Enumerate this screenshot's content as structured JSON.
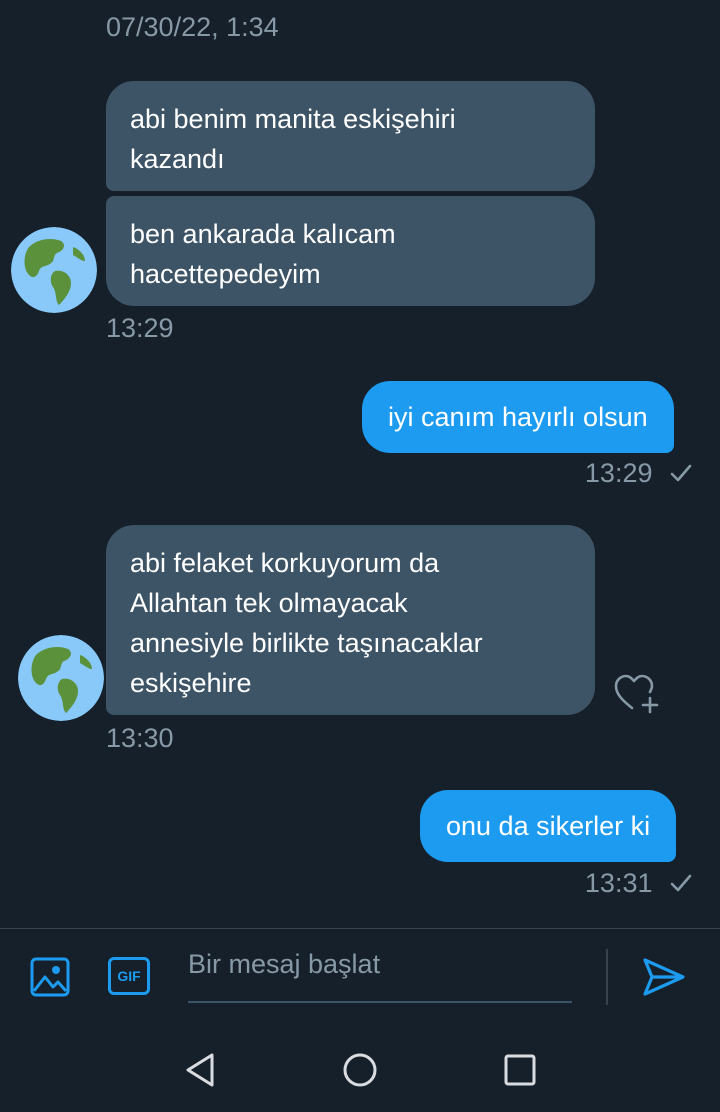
{
  "conversation": {
    "top_timestamp": "07/30/22, 1:34",
    "groups": [
      {
        "direction": "incoming",
        "messages": [
          {
            "lines": [
              "abi benim manita eskişehiri",
              "kazandı"
            ]
          },
          {
            "lines": [
              "ben ankarada kalıcam",
              "hacettepedeyim"
            ]
          }
        ],
        "time": "13:29"
      },
      {
        "direction": "outgoing",
        "messages": [
          {
            "lines": [
              "iyi canım hayırlı olsun"
            ]
          }
        ],
        "time": "13:29"
      },
      {
        "direction": "incoming",
        "messages": [
          {
            "lines": [
              "abi felaket korkuyorum da",
              "Allahtan tek olmayacak",
              "annesiyle birlikte taşınacaklar",
              "eskişehire"
            ]
          }
        ],
        "time": "13:30"
      },
      {
        "direction": "outgoing",
        "messages": [
          {
            "lines": [
              "onu da sikerler ki"
            ]
          }
        ],
        "time": "13:31"
      }
    ]
  },
  "composer": {
    "placeholder": "Bir mesaj başlat",
    "gif_label": "GIF"
  },
  "icons": {
    "avatar": "earth-globe-icon",
    "read_receipt": "checkmark-icon",
    "react": "heart-plus-icon",
    "image": "image-icon",
    "gif": "gif-icon",
    "send": "send-icon",
    "nav_back": "back-triangle-icon",
    "nav_home": "home-circle-icon",
    "nav_recents": "recents-square-icon"
  },
  "colors": {
    "background": "#15202b",
    "incoming_bubble": "#3d5466",
    "outgoing_bubble": "#1d9bf0",
    "accent": "#1d9bf0",
    "muted_text": "#8899a6"
  }
}
